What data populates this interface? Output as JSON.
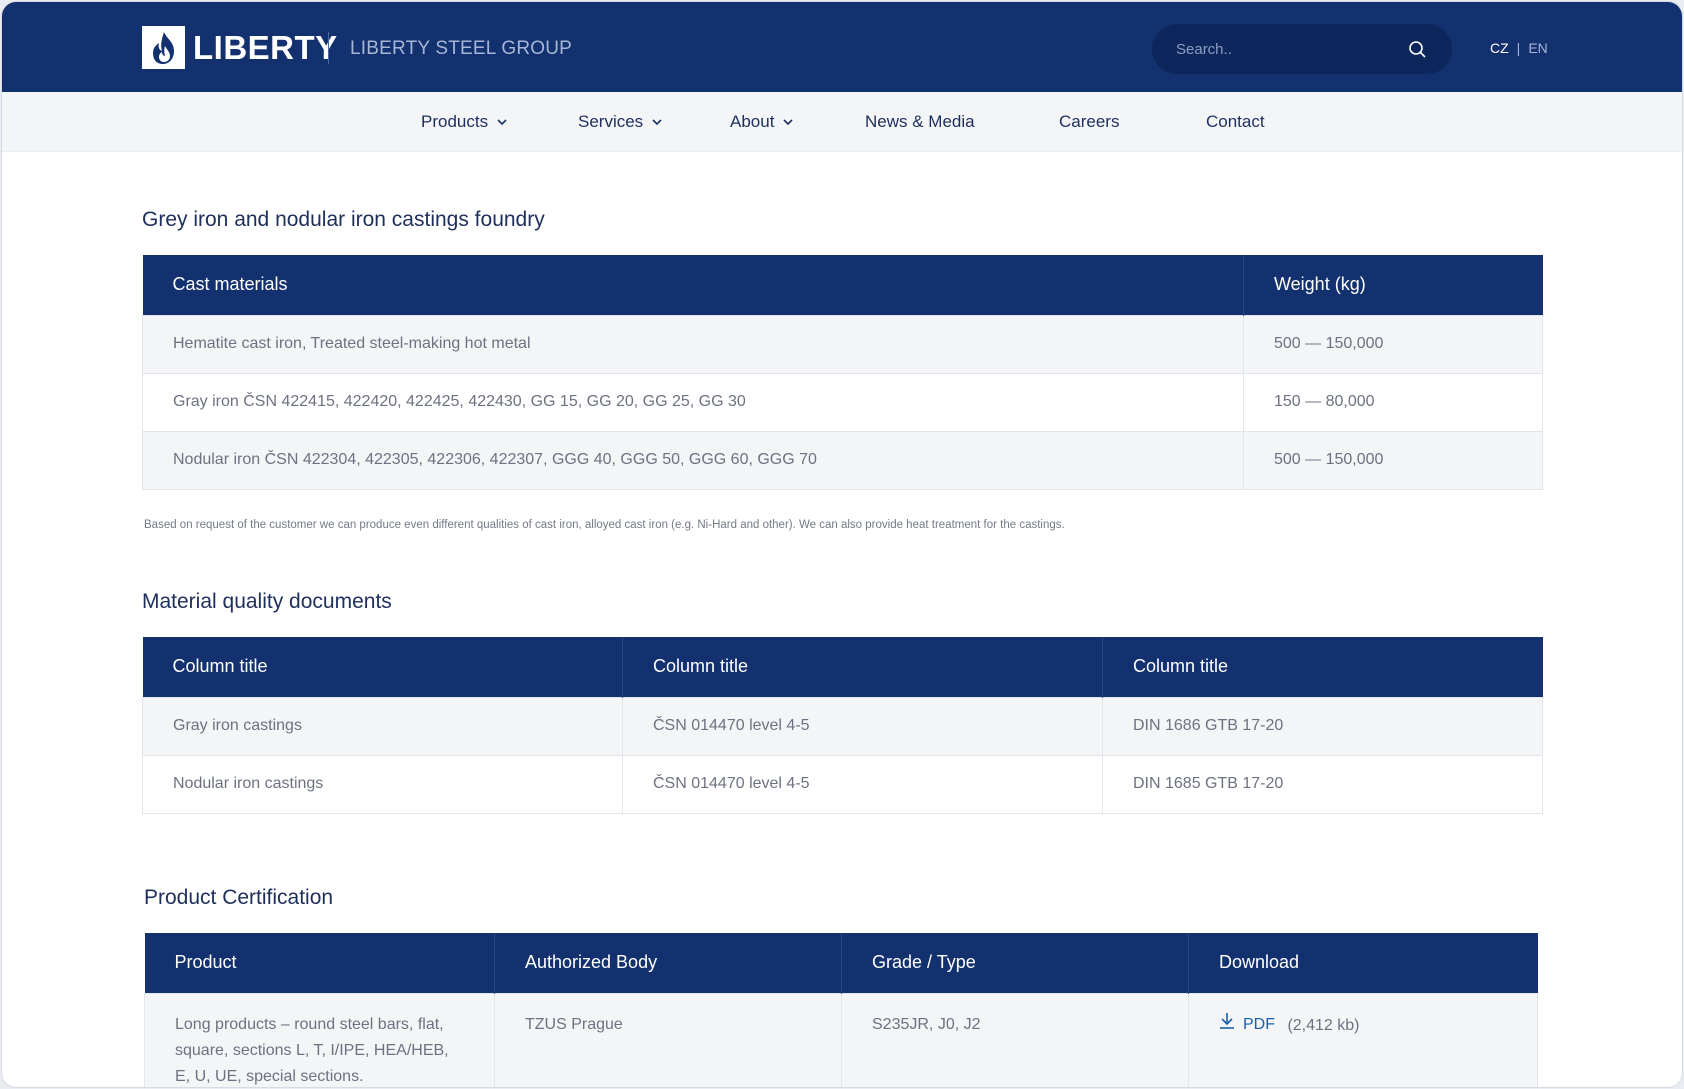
{
  "header": {
    "logo_text": "LIBERTY",
    "group_name": "LIBERTY STEEL GROUP",
    "search_placeholder": "Search..",
    "lang": {
      "cz": "CZ",
      "separator": "|",
      "en": "EN"
    }
  },
  "nav": {
    "products": "Products",
    "services": "Services",
    "about": "About",
    "news": "News & Media",
    "careers": "Careers",
    "contact": "Contact"
  },
  "foundry": {
    "title": "Grey iron and nodular iron castings foundry",
    "headers": [
      "Cast materials",
      "Weight (kg)"
    ],
    "rows": [
      [
        "Hematite cast iron, Treated steel-making hot metal",
        "500 — 150,000"
      ],
      [
        "Gray iron ČSN 422415, 422420, 422425, 422430, GG 15, GG 20, GG 25, GG 30",
        "150 — 80,000"
      ],
      [
        "Nodular iron ČSN 422304, 422305, 422306, 422307, GGG 40, GGG 50, GGG 60, GGG 70",
        "500 — 150,000"
      ]
    ],
    "note": "Based on request of the customer we can produce even different qualities of cast iron, alloyed cast iron (e.g. Ni-Hard and other). We can also provide heat treatment for the castings."
  },
  "quality": {
    "title": "Material quality documents",
    "headers": [
      "Column title",
      "Column title",
      "Column title"
    ],
    "rows": [
      [
        "Gray iron castings",
        "ČSN 014470 level 4-5",
        "DIN 1686 GTB 17-20"
      ],
      [
        "Nodular iron castings",
        "ČSN 014470 level 4-5",
        "DIN 1685 GTB 17-20"
      ]
    ]
  },
  "certification": {
    "title": "Product Certification",
    "headers": [
      "Product",
      "Authorized Body",
      "Grade / Type",
      "Download"
    ],
    "rows": [
      {
        "product": "Long products – round steel bars, flat, square, sections L, T, I/IPE, HEA/HEB, E, U, UE, special sections.",
        "body": "TZUS Prague",
        "grade": "S235JR, J0, J2",
        "download_label": "PDF",
        "download_size": "(2,412 kb)"
      }
    ]
  },
  "colors": {
    "brand_navy": "#13316e",
    "nav_bg": "#f4f5f7",
    "link_blue": "#1a5fae"
  }
}
